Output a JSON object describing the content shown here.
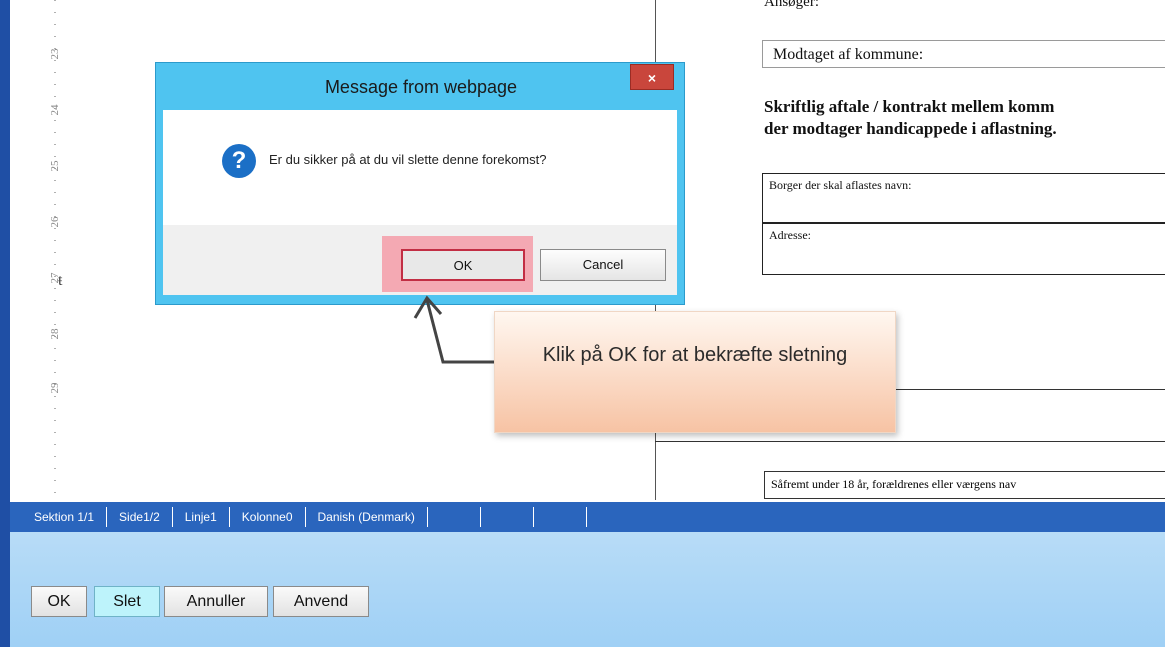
{
  "ruler": {
    "numbers": [
      "23",
      "24",
      "25",
      "26",
      "27",
      "28",
      "29"
    ]
  },
  "document": {
    "top_fragment": "Ansøger:",
    "received_label": "Modtaget af kommune:",
    "heading_line1": "Skriftlig aftale / kontrakt mellem komm",
    "heading_line2": "der modtager handicappede i aflastning.",
    "field_name_label": "Borger der skal aflastes navn:",
    "field_address_label": "Adresse:",
    "guardian_label": "Såfremt under 18 år, forældrenes eller værgens nav"
  },
  "dialog": {
    "title": "Message from webpage",
    "close_label": "×",
    "message": "Er du sikker på at du vil slette denne forekomst?",
    "ok_label": "OK",
    "cancel_label": "Cancel",
    "icon": "question-icon"
  },
  "callout": {
    "text": "Klik på OK for at bekræfte sletning"
  },
  "status_bar": {
    "items": [
      "Sektion 1/1",
      "Side1/2",
      "Linje1",
      "Kolonne0",
      "Danish (Denmark)"
    ]
  },
  "bottom_buttons": {
    "ok": "OK",
    "slet": "Slet",
    "annuller": "Annuller",
    "anvend": "Anvend"
  },
  "colors": {
    "status_bar": "#2a65bd",
    "dialog_frame": "#4fc4f0",
    "ok_highlight": "#f4a9b3",
    "bottom_panel": "#a8d5f6",
    "slet_button": "#bdf3fb"
  }
}
